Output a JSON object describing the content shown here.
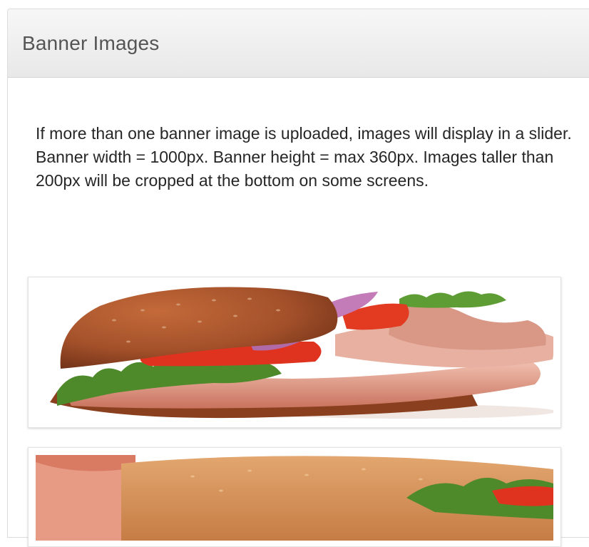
{
  "panel": {
    "title": "Banner Images"
  },
  "help": {
    "line1": "If more than one banner image is uploaded, images will display in a slider.",
    "line2": "Banner width = 1000px. Banner height = max 360px. Images taller than 200px will be cropped at the bottom on some screens."
  },
  "banners": [
    {
      "image": "sandwich-banner-image"
    },
    {
      "image": "sandwich-banner-image"
    }
  ],
  "colors": {
    "header_top": "#f7f7f7",
    "header_bottom": "#e8e8e8",
    "title_text": "#555555",
    "body_text": "#262626",
    "bread": "#a8552e",
    "lettuce": "#4e8a2a",
    "tomato": "#e0331f",
    "onion": "#b06aa8",
    "ham": "#e7a48f"
  }
}
